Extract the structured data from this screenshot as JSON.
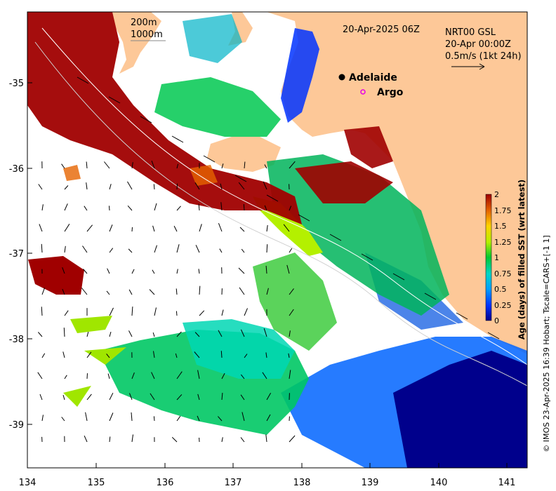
{
  "title": "20-Apr-2025 06Z",
  "depth_legend": {
    "line1": "200m",
    "line2": "1000m"
  },
  "product": {
    "line1": "NRT00 GSL",
    "line2": "20-Apr 00:00Z",
    "line3": "0.5m/s (1kt 24h)"
  },
  "places": [
    {
      "name": "Adelaide",
      "marker": "filled-circle",
      "color": "#000000",
      "lon": 138.6,
      "lat": -34.93
    },
    {
      "name": "Argo",
      "marker": "open-circle",
      "color": "#e600e6",
      "lon": 138.87,
      "lat": -35.12
    }
  ],
  "x_ticks": [
    "134",
    "135",
    "136",
    "137",
    "138",
    "139",
    "140",
    "141"
  ],
  "y_ticks": [
    "-35",
    "-36",
    "-37",
    "-38",
    "-39"
  ],
  "colorbar": {
    "label": "Age (days) of filled SST (wrt latest)",
    "ticks": [
      "2",
      "1.75",
      "1.5",
      "1.25",
      "1",
      "0.75",
      "0.5",
      "0.25",
      "0"
    ],
    "range": [
      0,
      2
    ]
  },
  "credit": "© IMOS 23-Apr-2025 16:39 Hobart; Tscale=CARS+[-1 1]",
  "colors": {
    "land": "#fdc898",
    "no_data": "#ffffff",
    "old_sst": "#a00000",
    "fresh_sst": "#00008c"
  }
}
